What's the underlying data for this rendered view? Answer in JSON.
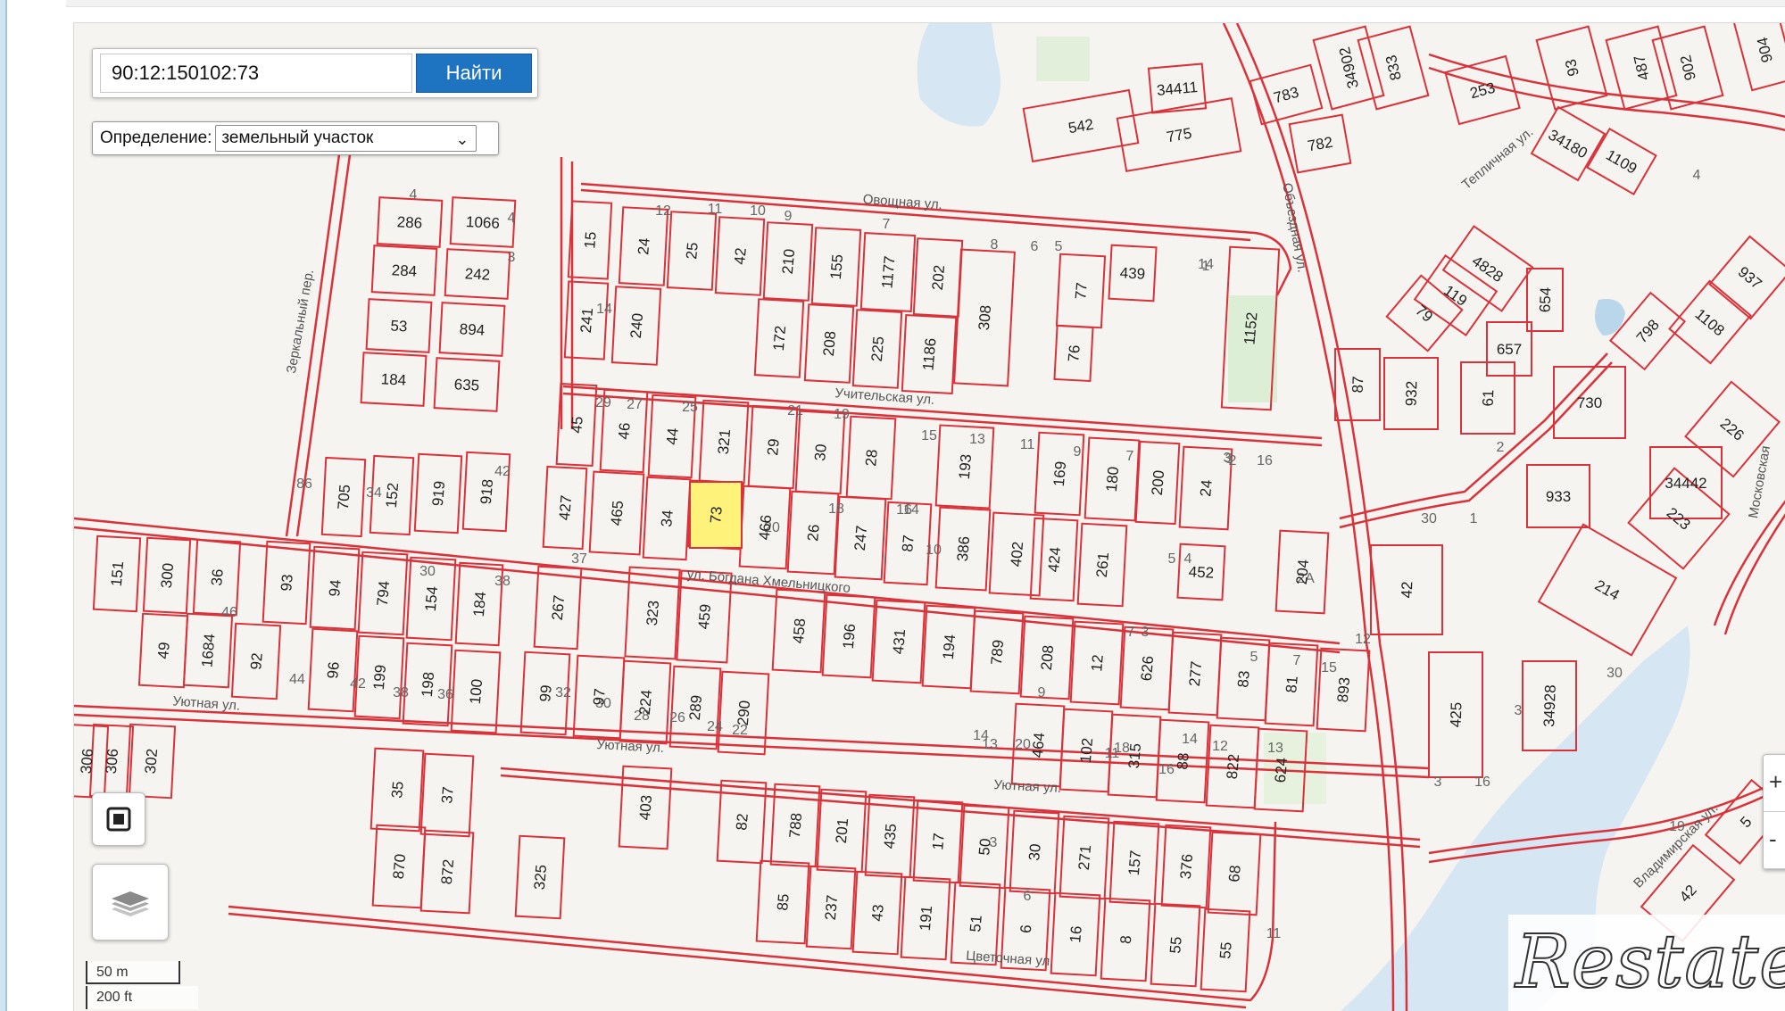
{
  "search": {
    "value": "90:12:150102:73",
    "button_label": "Найти"
  },
  "definition": {
    "label": "Определение:",
    "selected": "земельный участок"
  },
  "scale": {
    "meters": "50 m",
    "feet": "200 ft"
  },
  "watermark": "Restate",
  "icons": {
    "fullscreen": "fullscreen-icon",
    "layers": "layers-icon"
  },
  "colors": {
    "parcel_border": "#d9323a",
    "road_border": "#d9323a",
    "highlight": "#fff27a",
    "water": "#d6e6f2",
    "background": "#f6f4f0"
  },
  "zoom": {
    "in": "+",
    "out": "-"
  },
  "map": {
    "streets": [
      "Овощная ул.",
      "Учительская ул.",
      "ул. Богдана Хмельницкого",
      "Уютная ул.",
      "Уютная ул.",
      "Уютная ул.",
      "Цветочная ул.",
      "Зеркальный пер.",
      "Объездная ул.",
      "Тепличная ул.",
      "Владимирская ул.",
      "Московская"
    ],
    "parcels": [
      "286",
      "1066",
      "284",
      "242",
      "53",
      "894",
      "184",
      "635",
      "15",
      "24",
      "25",
      "42",
      "210",
      "155",
      "1177",
      "202",
      "241",
      "240",
      "172",
      "208",
      "225",
      "1186",
      "308",
      "77",
      "439",
      "76",
      "1152",
      "45",
      "46",
      "44",
      "321",
      "29",
      "30",
      "28",
      "193",
      "169",
      "180",
      "200",
      "24",
      "427",
      "465",
      "34",
      "73",
      "466",
      "26",
      "247",
      "87",
      "386",
      "402",
      "424",
      "261",
      "452",
      "204",
      "705",
      "152",
      "919",
      "918",
      "151",
      "300",
      "36",
      "93",
      "94",
      "794",
      "154",
      "184",
      "267",
      "323",
      "459",
      "458",
      "196",
      "431",
      "194",
      "789",
      "208",
      "12",
      "626",
      "277",
      "83",
      "81",
      "893",
      "49",
      "1684",
      "92",
      "96",
      "199",
      "198",
      "100",
      "99",
      "97",
      "224",
      "289",
      "290",
      "464",
      "102",
      "315",
      "88",
      "822",
      "624",
      "306",
      "306",
      "302",
      "35",
      "37",
      "870",
      "872",
      "403",
      "82",
      "788",
      "201",
      "435",
      "17",
      "50",
      "30",
      "271",
      "157",
      "376",
      "68",
      "325",
      "85",
      "237",
      "43",
      "191",
      "51",
      "6",
      "16",
      "8",
      "55",
      "55",
      "34411",
      "542",
      "775",
      "783",
      "782",
      "34902",
      "833",
      "253",
      "93",
      "487",
      "902",
      "904",
      "34180",
      "1109",
      "4828",
      "119",
      "79",
      "654",
      "657",
      "61",
      "932",
      "87",
      "798",
      "1108",
      "937",
      "730",
      "226",
      "34442",
      "933",
      "223",
      "214",
      "42",
      "425",
      "34928",
      "5",
      "42"
    ],
    "house_numbers": [
      "4",
      "4",
      "3",
      "12",
      "11",
      "10",
      "9",
      "7",
      "8",
      "6",
      "5",
      "1",
      "14",
      "29",
      "27",
      "25",
      "21",
      "19",
      "15",
      "13",
      "11",
      "9",
      "7",
      "3",
      "2",
      "20",
      "18",
      "16",
      "14",
      "10",
      "5",
      "4",
      "2А",
      "86",
      "34",
      "42",
      "38",
      "30",
      "37",
      "46",
      "44",
      "42",
      "38",
      "36",
      "32",
      "30",
      "28",
      "26",
      "24",
      "22",
      "20",
      "18",
      "16",
      "14",
      "12",
      "13",
      "9",
      "7",
      "3",
      "3",
      "5",
      "7",
      "15",
      "12",
      "14",
      "13",
      "11",
      "3",
      "16",
      "14",
      "30",
      "1",
      "2",
      "3",
      "3",
      "4",
      "16",
      "30",
      "19",
      "11",
      "6"
    ]
  }
}
